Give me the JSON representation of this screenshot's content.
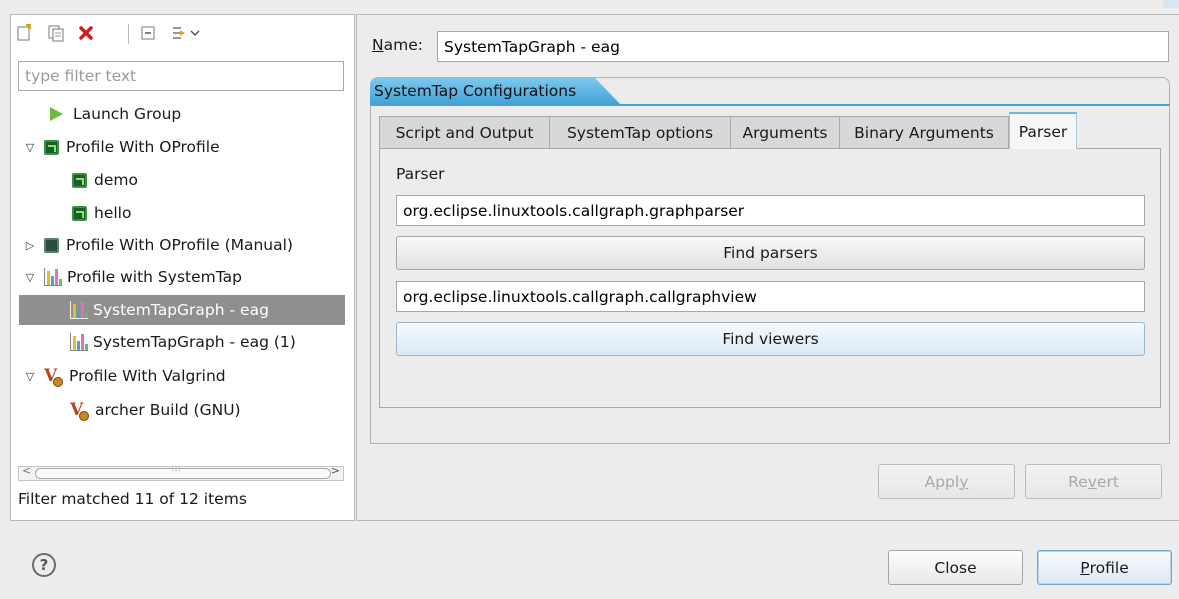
{
  "left": {
    "filter_placeholder": "type filter text",
    "tree": [
      {
        "label": "Launch Group"
      },
      {
        "label": "Profile With OProfile"
      },
      {
        "label": "demo"
      },
      {
        "label": "hello"
      },
      {
        "label": "Profile With OProfile (Manual)"
      },
      {
        "label": "Profile with SystemTap"
      },
      {
        "label": "SystemTapGraph - eag",
        "selected": true
      },
      {
        "label": "SystemTapGraph - eag (1)"
      },
      {
        "label": "Profile With Valgrind"
      },
      {
        "label": "archer Build (GNU)"
      }
    ],
    "filter_status": "Filter matched 11 of 12 items"
  },
  "right": {
    "name_label_mnemonic": "N",
    "name_label_rest": "ame:",
    "name_value": "SystemTapGraph - eag",
    "config_tab": "SystemTap Configurations",
    "sub_tabs": [
      "Script and Output",
      "SystemTap options",
      "Arguments",
      "Binary Arguments",
      "Parser"
    ],
    "active_sub_tab": "Parser",
    "parser_section_label": "Parser",
    "parser_value": "org.eclipse.linuxtools.callgraph.graphparser",
    "find_parsers_label": "Find parsers",
    "viewer_value": "org.eclipse.linuxtools.callgraph.callgraphview",
    "find_viewers_label": "Find viewers",
    "apply_pre": "Appl",
    "apply_mn": "y",
    "revert_pre": "Re",
    "revert_mn": "v",
    "revert_post": "ert"
  },
  "footer": {
    "help": "?",
    "close_label": "Close",
    "profile_mn": "P",
    "profile_rest": "rofile"
  },
  "colors": {
    "accent_tab": "#3f9fd4",
    "selection": "#8f8f8f"
  },
  "icons": [
    "new-config-icon",
    "duplicate-icon",
    "delete-icon",
    "collapse-all-icon",
    "filter-icon",
    "help-icon"
  ]
}
